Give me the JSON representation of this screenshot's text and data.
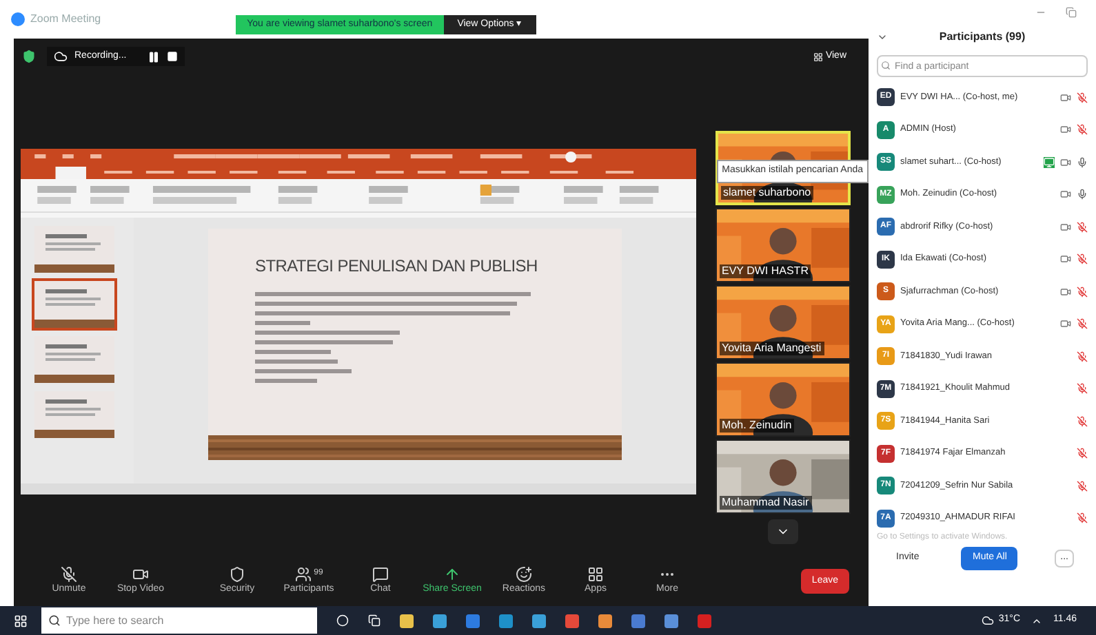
{
  "window": {
    "title": "Zoom Meeting"
  },
  "share_banner": {
    "text": "You are viewing slamet suharbono's screen",
    "options": "View Options ▾"
  },
  "top_bar": {
    "recording": "Recording...",
    "view": "View"
  },
  "slide": {
    "title": "STRATEGI PENULISAN DAN PUBLISH"
  },
  "tooltip": "Masukkan istilah pencarian Anda",
  "video_tiles": [
    {
      "name": "slamet suharbono",
      "kind": "banner",
      "speaking": true
    },
    {
      "name": "EVY DWI HASTR",
      "kind": "banner",
      "speaking": false
    },
    {
      "name": "Yovita Aria Mangesti",
      "kind": "banner",
      "speaking": false
    },
    {
      "name": "Moh. Zeinudin",
      "kind": "banner",
      "speaking": false
    },
    {
      "name": "Muhammad Nasir",
      "kind": "room",
      "speaking": false
    }
  ],
  "toolbar": [
    {
      "kind": "mic",
      "label": "Unmute",
      "active": false
    },
    {
      "kind": "video",
      "label": "Stop Video",
      "active": false
    },
    {
      "kind": "security",
      "label": "Security",
      "active": false
    },
    {
      "kind": "participants",
      "label": "Participants",
      "count": "99",
      "active": false
    },
    {
      "kind": "chat",
      "label": "Chat",
      "active": false
    },
    {
      "kind": "share",
      "label": "Share Screen",
      "active": true
    },
    {
      "kind": "reactions",
      "label": "Reactions",
      "active": false
    },
    {
      "kind": "apps",
      "label": "Apps",
      "active": false
    },
    {
      "kind": "more",
      "label": "More",
      "active": false
    }
  ],
  "leave_button": "Leave",
  "participants_panel": {
    "title": "Participants (99)",
    "search_placeholder": "Find a participant",
    "participants": [
      {
        "initials": "ED",
        "name": "EVY DWI HA... (Co-host, me)",
        "color": "#2d3748",
        "video": true,
        "muted": true,
        "sharing": false
      },
      {
        "initials": "A",
        "name": "ADMIN (Host)",
        "color": "#178a6a",
        "video": true,
        "muted": true,
        "sharing": false
      },
      {
        "initials": "SS",
        "name": "slamet suhart... (Co-host)",
        "color": "#17897a",
        "video": true,
        "muted": false,
        "sharing": true
      },
      {
        "initials": "MZ",
        "name": "Moh. Zeinudin (Co-host)",
        "color": "#38a35a",
        "video": true,
        "muted": false,
        "sharing": false
      },
      {
        "initials": "AF",
        "name": "abdrorif Rifky (Co-host)",
        "color": "#2b6cb0",
        "video": true,
        "muted": true,
        "sharing": false
      },
      {
        "initials": "IK",
        "name": "Ida Ekawati (Co-host)",
        "color": "#2d3748",
        "video": true,
        "muted": true,
        "sharing": false
      },
      {
        "initials": "S",
        "name": "Sjafurrachman (Co-host)",
        "color": "#cc5a1a",
        "video": true,
        "muted": true,
        "sharing": false
      },
      {
        "initials": "YA",
        "name": "Yovita Aria Mang... (Co-host)",
        "color": "#e8a317",
        "video": true,
        "muted": true,
        "sharing": false
      },
      {
        "initials": "7I",
        "name": "71841830_Yudi Irawan",
        "color": "#e89a17",
        "video": false,
        "muted": true,
        "sharing": false
      },
      {
        "initials": "7M",
        "name": "71841921_Khoulit Mahmud",
        "color": "#2d3748",
        "video": false,
        "muted": true,
        "sharing": false
      },
      {
        "initials": "7S",
        "name": "71841944_Hanita Sari",
        "color": "#e8a317",
        "video": false,
        "muted": true,
        "sharing": false
      },
      {
        "initials": "7F",
        "name": "71841974 Fajar Elmanzah",
        "color": "#c53030",
        "video": false,
        "muted": true,
        "sharing": false
      },
      {
        "initials": "7N",
        "name": "72041209_Sefrin Nur Sabila",
        "color": "#17897a",
        "video": false,
        "muted": true,
        "sharing": false
      },
      {
        "initials": "7A",
        "name": "72049310_AHMADUR RIFAI",
        "color": "#2b6cb0",
        "video": false,
        "muted": true,
        "sharing": false
      }
    ],
    "activation_note": "Go to Settings to activate Windows.",
    "invite": "Invite",
    "mute_all": "Mute All",
    "more": "..."
  },
  "taskbar": {
    "search_placeholder": "Type here to search",
    "weather": "31°C",
    "time": "11.46"
  }
}
